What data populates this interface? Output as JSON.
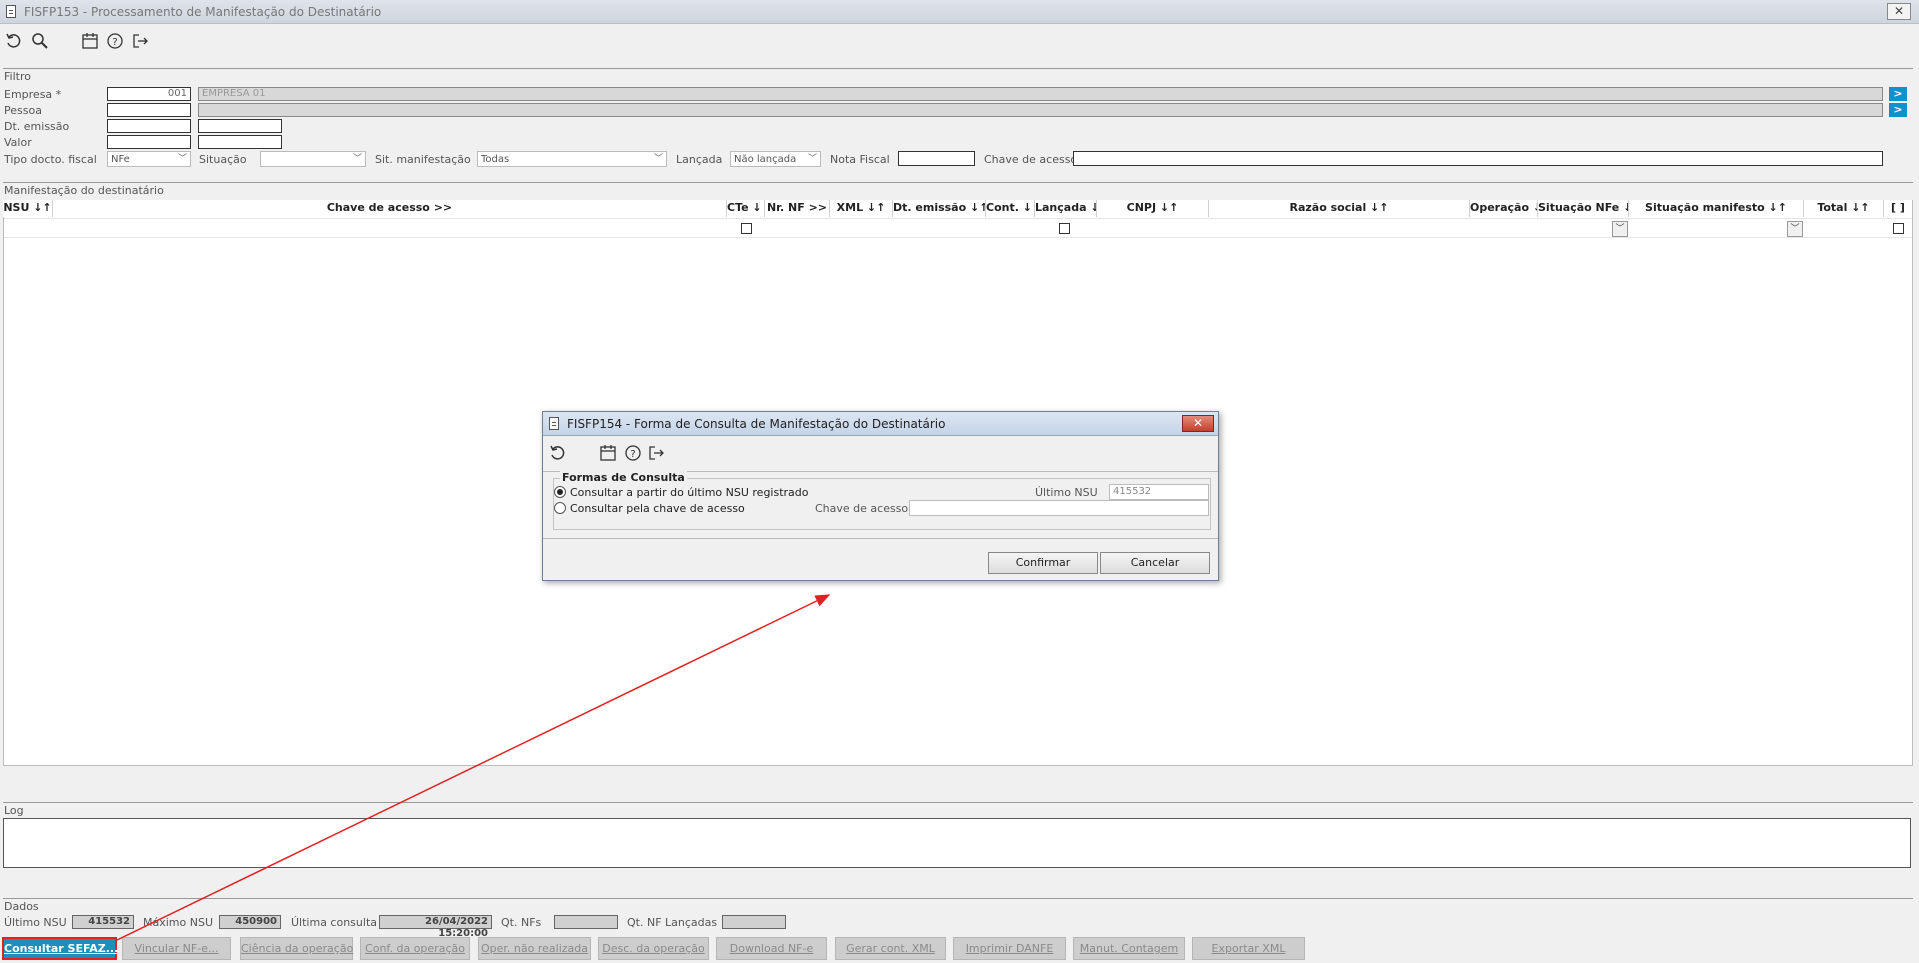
{
  "window": {
    "title": "FISFP153 - Processamento de Manifestação do Destinatário",
    "close_glyph": "✕"
  },
  "toolbar": {
    "icons": [
      "undo-icon",
      "search-icon",
      "calendar-icon",
      "help-icon",
      "exit-icon"
    ]
  },
  "filtro": {
    "title": "Filtro",
    "empresa_label": "Empresa *",
    "empresa_code": "001",
    "empresa_name": "EMPRESA 01",
    "pessoa_label": "Pessoa",
    "dt_emissao_label": "Dt. emissão",
    "valor_label": "Valor",
    "tipo_docto_label": "Tipo docto. fiscal",
    "tipo_docto_value": "NFe",
    "situacao_label": "Situação",
    "situacao_value": "",
    "sit_manifestacao_label": "Sit. manifestação",
    "sit_manifestacao_value": "Todas",
    "lancada_label": "Lançada",
    "lancada_value": "Não lançada",
    "nota_fiscal_label": "Nota Fiscal",
    "chave_acesso_label": "Chave de acesso",
    "go_glyph": ">"
  },
  "manifestacao": {
    "title": "Manifestação do destinatário",
    "columns": [
      "NSU ↓↑",
      "Chave de acesso >>",
      "CTe ↓↑",
      "Nr. NF >>",
      "XML ↓↑",
      "Dt. emissão ↓↑",
      "Cont. ↓↑",
      "Lançada ↓↑",
      "CNPJ ↓↑",
      "Razão social ↓↑",
      "Operação ↓↑",
      "Situação NFe ↓↑",
      "Situação manifesto ↓↑",
      "Total ↓↑",
      "[ ]"
    ]
  },
  "log": {
    "title": "Log"
  },
  "dados": {
    "title": "Dados",
    "ultimo_nsu_label": "Último NSU",
    "ultimo_nsu_value": "415532",
    "maximo_nsu_label": "Máximo NSU",
    "maximo_nsu_value": "450900",
    "ultima_consulta_label": "Última consulta",
    "ultima_consulta_value": "26/04/2022 15:20:00",
    "qt_nfs_label": "Qt. NFs",
    "qt_nf_lancadas_label": "Qt. NF Lançadas"
  },
  "actions": [
    "Consultar SEFAZ...",
    "Vincular NF-e...",
    "Ciência da operação",
    "Conf. da operação",
    "Oper. não realizada",
    "Desc. da operação",
    "Download NF-e",
    "Gerar cont. XML",
    "Imprimir DANFE",
    "Manut. Contagem",
    "Exportar XML"
  ],
  "dialog": {
    "title": "FISFP154 - Forma de Consulta de Manifestação do Destinatário",
    "close_glyph": "✕",
    "group_title": "Formas de Consulta",
    "option1": "Consultar a partir do último NSU registrado",
    "option2": "Consultar pela chave de acesso",
    "ultimo_nsu_label": "Último NSU",
    "ultimo_nsu_value": "415532",
    "chave_label": "Chave de acesso",
    "confirm_label": "Confirmar",
    "cancel_label": "Cancelar"
  },
  "colors": {
    "accent": "#0d93c7",
    "annotation": "#e12222"
  }
}
